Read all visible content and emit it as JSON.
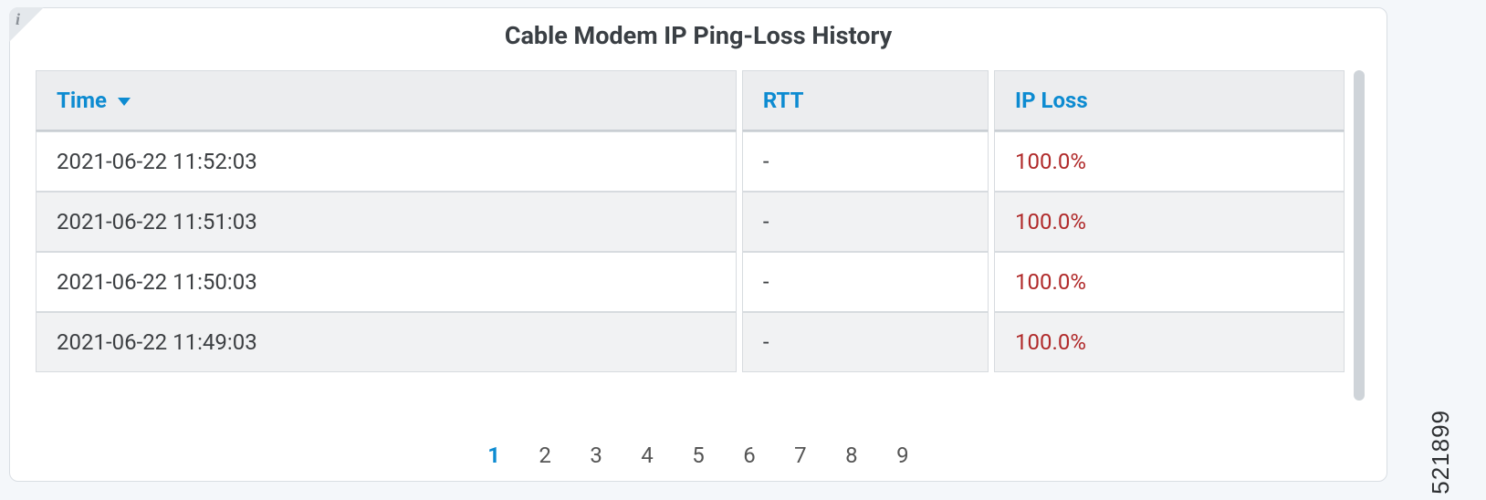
{
  "panel": {
    "title": "Cable Modem IP Ping-Loss History",
    "info_tooltip": "i"
  },
  "table": {
    "columns": {
      "time": "Time",
      "rtt": "RTT",
      "loss": "IP Loss"
    },
    "sorted_column": "time",
    "sort_direction": "desc",
    "rows": [
      {
        "time": "2021-06-22 11:52:03",
        "rtt": "-",
        "loss": "100.0%"
      },
      {
        "time": "2021-06-22 11:51:03",
        "rtt": "-",
        "loss": "100.0%"
      },
      {
        "time": "2021-06-22 11:50:03",
        "rtt": "-",
        "loss": "100.0%"
      },
      {
        "time": "2021-06-22 11:49:03",
        "rtt": "-",
        "loss": "100.0%"
      }
    ]
  },
  "pagination": {
    "active_page": 1,
    "pages": [
      "1",
      "2",
      "3",
      "4",
      "5",
      "6",
      "7",
      "8",
      "9"
    ]
  },
  "doc_id": "521899"
}
